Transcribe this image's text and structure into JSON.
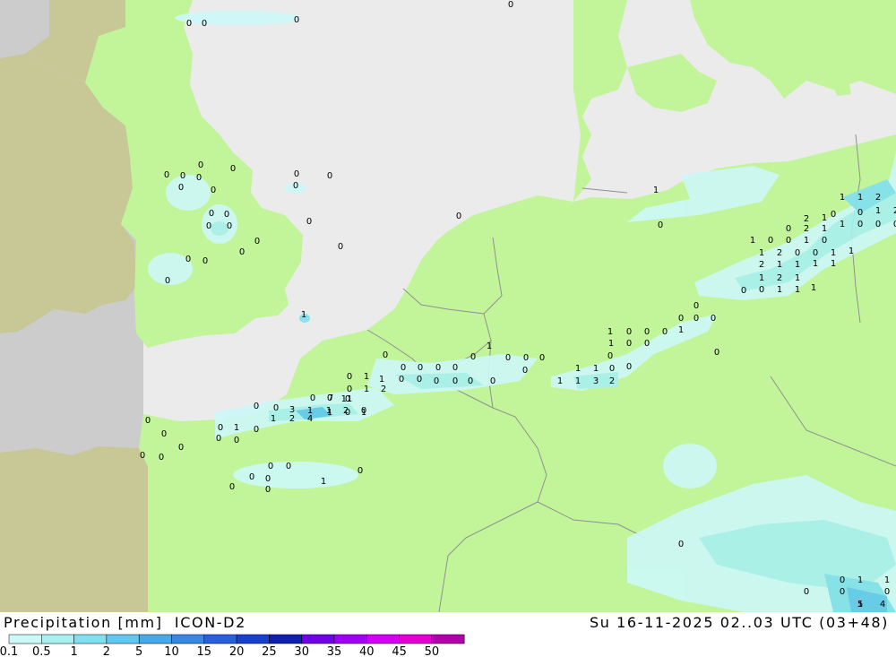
{
  "footer": {
    "title": "Precipitation [mm]  ICON-D2",
    "datetime": "Su 16-11-2025 02..03 UTC (03+48)"
  },
  "legend": {
    "ticks": [
      "0.1",
      "0.5",
      "1",
      "2",
      "5",
      "10",
      "15",
      "20",
      "25",
      "30",
      "35",
      "40",
      "45",
      "50"
    ],
    "colors": [
      "#ccf8f8",
      "#a8f0f0",
      "#80e0f0",
      "#60c8f0",
      "#48a8e8",
      "#3888e0",
      "#2860d8",
      "#1840c8",
      "#1020a8",
      "#7000e0",
      "#a000f0",
      "#d000f0",
      "#e000d0",
      "#b000a8"
    ]
  },
  "map_colors": {
    "land": "#c2f59a",
    "sea": "#ebebeb",
    "outside_domain_land": "#c8c896",
    "outside_domain_sea": "#cccccc",
    "border": "#909090"
  },
  "precip_values": [
    {
      "t": "0"
    },
    {
      "t": "0"
    },
    {
      "t": "0"
    },
    {
      "t": "0"
    },
    {
      "t": "0"
    },
    {
      "t": "0"
    },
    {
      "t": "0"
    },
    {
      "t": "0"
    },
    {
      "t": "0"
    },
    {
      "t": "0"
    },
    {
      "t": "0"
    },
    {
      "t": "0"
    },
    {
      "t": "0"
    },
    {
      "t": "0"
    },
    {
      "t": "0"
    },
    {
      "t": "0"
    },
    {
      "t": "0"
    },
    {
      "t": "0"
    },
    {
      "t": "0"
    },
    {
      "t": "0"
    },
    {
      "t": "0"
    },
    {
      "t": "1"
    },
    {
      "t": "0"
    },
    {
      "t": "0"
    },
    {
      "t": "0"
    },
    {
      "t": "0"
    },
    {
      "t": "0"
    },
    {
      "t": "1"
    },
    {
      "t": "0"
    },
    {
      "t": "0"
    },
    {
      "t": "0"
    },
    {
      "t": "0"
    },
    {
      "t": "0"
    },
    {
      "t": "0"
    },
    {
      "t": "0"
    },
    {
      "t": "0"
    },
    {
      "t": "0"
    },
    {
      "t": "0"
    },
    {
      "t": "1"
    },
    {
      "t": "0"
    },
    {
      "t": "0"
    },
    {
      "t": "0"
    },
    {
      "t": "0"
    },
    {
      "t": "0"
    },
    {
      "t": "0"
    },
    {
      "t": "0"
    },
    {
      "t": "1"
    },
    {
      "t": "0"
    },
    {
      "t": "1"
    },
    {
      "t": "2"
    },
    {
      "t": "0"
    },
    {
      "t": "0"
    },
    {
      "t": "3"
    },
    {
      "t": "1"
    },
    {
      "t": "1"
    },
    {
      "t": "0"
    },
    {
      "t": "1"
    },
    {
      "t": "0"
    },
    {
      "t": "0"
    },
    {
      "t": "0"
    },
    {
      "t": "0"
    },
    {
      "t": "1"
    },
    {
      "t": "2"
    },
    {
      "t": "4"
    },
    {
      "t": "1"
    },
    {
      "t": "2"
    },
    {
      "t": "0"
    },
    {
      "t": "7"
    },
    {
      "t": "11"
    },
    {
      "t": "0"
    },
    {
      "t": "1"
    },
    {
      "t": "0"
    },
    {
      "t": "0"
    },
    {
      "t": "0"
    },
    {
      "t": "0"
    },
    {
      "t": "0"
    },
    {
      "t": "0"
    },
    {
      "t": "0"
    },
    {
      "t": "0"
    },
    {
      "t": "0"
    },
    {
      "t": "0"
    },
    {
      "t": "0"
    },
    {
      "t": "0"
    },
    {
      "t": "0"
    },
    {
      "t": "1"
    },
    {
      "t": "0"
    },
    {
      "t": "1"
    },
    {
      "t": "1"
    },
    {
      "t": "3"
    },
    {
      "t": "2"
    },
    {
      "t": "0"
    },
    {
      "t": "1"
    },
    {
      "t": "1"
    },
    {
      "t": "0"
    },
    {
      "t": "0"
    },
    {
      "t": "1"
    },
    {
      "t": "0"
    },
    {
      "t": "0"
    },
    {
      "t": "1"
    },
    {
      "t": "0"
    },
    {
      "t": "0"
    },
    {
      "t": "0"
    },
    {
      "t": "1"
    },
    {
      "t": "0"
    },
    {
      "t": "0"
    },
    {
      "t": "0"
    },
    {
      "t": "0"
    },
    {
      "t": "0"
    },
    {
      "t": "0"
    },
    {
      "t": "1"
    },
    {
      "t": "1"
    },
    {
      "t": "2"
    },
    {
      "t": "2"
    },
    {
      "t": "1"
    },
    {
      "t": "0"
    },
    {
      "t": "0"
    },
    {
      "t": "1"
    },
    {
      "t": "1"
    },
    {
      "t": "1"
    },
    {
      "t": "0"
    },
    {
      "t": "0"
    },
    {
      "t": "1"
    },
    {
      "t": "1"
    },
    {
      "t": "1"
    },
    {
      "t": "1"
    },
    {
      "t": "1"
    },
    {
      "t": "1"
    },
    {
      "t": "1"
    },
    {
      "t": "2"
    },
    {
      "t": "2"
    },
    {
      "t": "2"
    },
    {
      "t": "1"
    },
    {
      "t": "1"
    },
    {
      "t": "0"
    },
    {
      "t": "0"
    },
    {
      "t": "0"
    },
    {
      "t": "1"
    },
    {
      "t": "0"
    },
    {
      "t": "0"
    },
    {
      "t": "1"
    },
    {
      "t": "0"
    },
    {
      "t": "1"
    },
    {
      "t": "2"
    },
    {
      "t": "0"
    },
    {
      "t": "0"
    },
    {
      "t": "1"
    },
    {
      "t": "1"
    },
    {
      "t": "0"
    },
    {
      "t": "2"
    },
    {
      "t": "1"
    },
    {
      "t": "0"
    },
    {
      "t": "0"
    },
    {
      "t": "1"
    },
    {
      "t": "0"
    },
    {
      "t": "1"
    },
    {
      "t": "5"
    },
    {
      "t": "4"
    },
    {
      "t": "1"
    },
    {
      "t": "0"
    },
    {
      "t": "0"
    }
  ]
}
